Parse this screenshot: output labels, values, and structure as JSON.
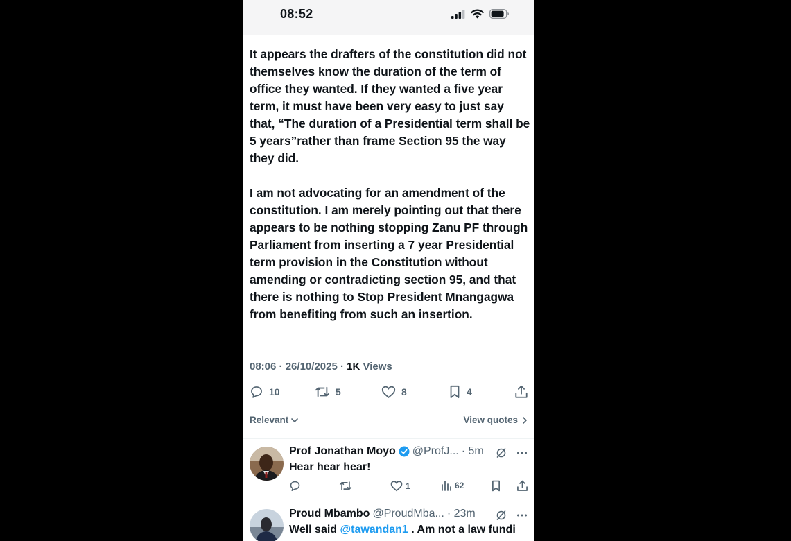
{
  "status": {
    "time": "08:52"
  },
  "tweet": {
    "body": "It appears the drafters of the constitution did not themselves know the duration of the term of office they wanted. If they wanted a five year term, it must have been very easy to just say that, “The duration of a Presidential term shall be 5 years”rather than frame Section 95 the way they did.\n\nI am not advocating for an amendment of the constitution.  I am merely pointing out that there appears to be nothing stopping Zanu PF through Parliament from inserting a 7 year Presidential term provision in the Constitution without amending or contradicting section 95, and that there is nothing to Stop President Mnangagwa from benefiting from such an insertion.",
    "time": "08:06",
    "date": "26/10/2025",
    "views_count": "1K",
    "views_label": "Views",
    "replies": "10",
    "reposts": "5",
    "likes": "8",
    "bookmarks": "4"
  },
  "sort": {
    "label": "Relevant",
    "quotes": "View quotes"
  },
  "replies": [
    {
      "name": "Prof Jonathan Moyo",
      "handle": "@ProfJ...",
      "age": "· 5m",
      "text": "Hear hear hear!",
      "likes": "1",
      "views": "62"
    },
    {
      "name": "Proud Mbambo",
      "handle": "@ProudMba...",
      "age": "· 23m",
      "text_before": "Well said ",
      "mention": "@tawandan1",
      "text_after": " . Am not a law fundi"
    }
  ]
}
